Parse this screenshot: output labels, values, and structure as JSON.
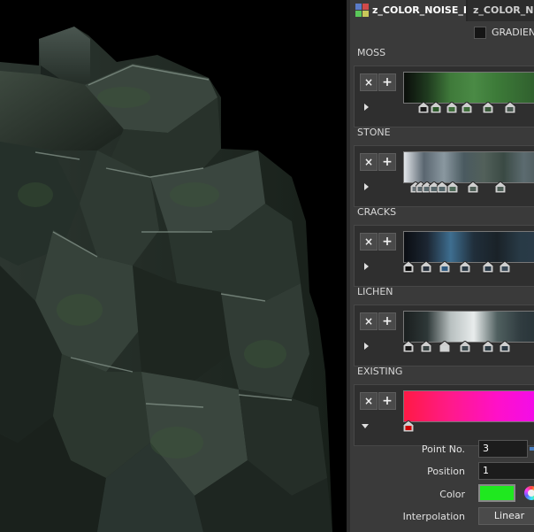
{
  "tabs": [
    {
      "label": "z_COLOR_NOISE_HI",
      "active": true
    },
    {
      "label": "z_COLOR_NO",
      "active": false
    }
  ],
  "gradient_toggle": {
    "label": "GRADIENT",
    "checked": false
  },
  "sections": [
    {
      "label": "MOSS",
      "expanded": false,
      "ramp_colors": [
        "#0a0d0a",
        "#1f3a1f",
        "#3f7a3a",
        "#4a8a45",
        "#3c7a38",
        "#356a32",
        "#2d5a2b"
      ],
      "handle_colors": [
        "#1a1a1a",
        "#2e5a2c",
        "#3f6e3b",
        "#3f6e3b",
        "#3a5a3a",
        "#4a5a50"
      ],
      "handle_positions": [
        0.12,
        0.22,
        0.35,
        0.47,
        0.64,
        0.82
      ]
    },
    {
      "label": "STONE",
      "expanded": false,
      "ramp_colors": [
        "#e2e6ea",
        "#5a6670",
        "#8a98a0",
        "#4a5a60",
        "#52605a",
        "#3a4a44",
        "#5c6b70",
        "#485555"
      ],
      "handle_colors": [
        "#6a7478",
        "#5c686c",
        "#5a6a6e",
        "#56666a",
        "#54666a",
        "#4e6a58",
        "#506058"
      ],
      "handle_positions": [
        0.06,
        0.1,
        0.15,
        0.21,
        0.27,
        0.36,
        0.52,
        0.74
      ]
    },
    {
      "label": "CRACKS",
      "expanded": false,
      "ramp_colors": [
        "#0a0d12",
        "#1c2632",
        "#3e6e90",
        "#202e3a",
        "#1a2228",
        "#283a46",
        "#2a3a48"
      ],
      "handle_colors": [
        "#0a0a0a",
        "#2a3440",
        "#2f5a80",
        "#2c3a46",
        "#2a3a48",
        "#3a4a58"
      ],
      "handle_positions": [
        0.0,
        0.14,
        0.29,
        0.46,
        0.64,
        0.78
      ]
    },
    {
      "label": "LICHEN",
      "expanded": false,
      "ramp_colors": [
        "#1a1e1e",
        "#2e3838",
        "#b8c0c0",
        "#e8ecec",
        "#506060",
        "#303c40",
        "#253036"
      ],
      "handle_colors": [
        "#1a1a1a",
        "#3a4444",
        "#d0d4d4",
        "#3e4c50",
        "#2f3e46",
        "#2c3a44"
      ],
      "handle_positions": [
        0.0,
        0.14,
        0.29,
        0.46,
        0.64,
        0.78
      ]
    },
    {
      "label": "EXISTING",
      "expanded": true,
      "ramp_colors": [
        "#ff1a45",
        "#ff1a8a",
        "#ff10c8",
        "#f00cf0"
      ],
      "handle_colors": [
        "#cc0000"
      ],
      "handle_positions": [
        0.0
      ]
    }
  ],
  "point_editor": {
    "point_no_label": "Point No.",
    "point_no_value": "3",
    "position_label": "Position",
    "position_value": "1",
    "color_label": "Color",
    "color_value": "#1fe81f",
    "interpolation_label": "Interpolation",
    "interpolation_value": "Linear"
  },
  "icons": {
    "remove_point": "×",
    "add_point": "+",
    "expand": "play-triangle-icon",
    "tab": "node-icon"
  }
}
